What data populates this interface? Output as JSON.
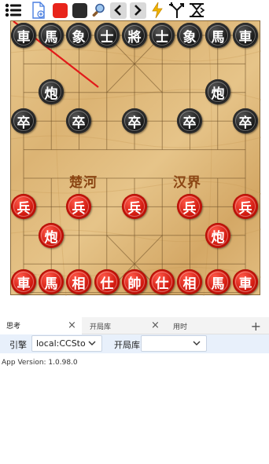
{
  "toolbar": {
    "icons": [
      "menu-icon",
      "new-file-icon",
      "red-square-icon",
      "black-square-icon",
      "search-icon",
      "chevron-left-icon",
      "chevron-right-icon",
      "lightning-icon",
      "branch-icon",
      "flip-icon"
    ],
    "colors": {
      "red": "#e8241b",
      "black": "#2b2b2b",
      "lightning": "#f0b400",
      "blue": "#4a7fe0"
    }
  },
  "board": {
    "river_left": "楚河",
    "river_right": "汉界",
    "black_back": [
      "車",
      "馬",
      "象",
      "士",
      "將",
      "士",
      "象",
      "馬",
      "車"
    ],
    "black_cannon": "炮",
    "black_pawn": "卒",
    "red_back": [
      "車",
      "馬",
      "相",
      "仕",
      "帥",
      "仕",
      "相",
      "馬",
      "車"
    ],
    "red_cannon": "炮",
    "red_pawn": "兵"
  },
  "tabs": [
    {
      "label": "思考",
      "active": true
    },
    {
      "label": "开局库",
      "active": false
    },
    {
      "label": "用时",
      "active": false
    }
  ],
  "tab_close": "×",
  "tab_add": "+",
  "engine": {
    "label": "引擎",
    "value": "local:CCSto",
    "book_label": "开局库",
    "book_value": ""
  },
  "app_version": "App Version: 1.0.98.0"
}
